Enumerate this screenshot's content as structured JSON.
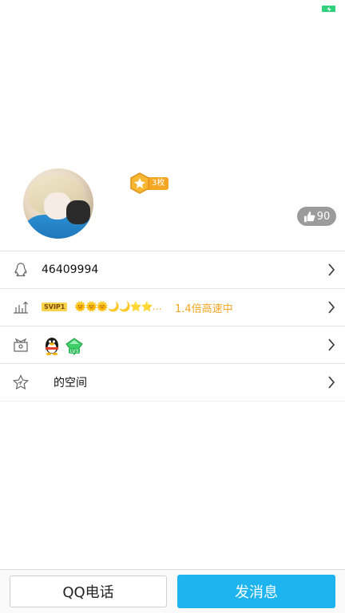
{
  "profile": {
    "medal_count": "3枚",
    "likes": "90"
  },
  "rows": [
    {
      "icon": "penguin-outline-icon",
      "text": "46409994"
    },
    {
      "icon": "level-chart-icon",
      "vip_tag": "SVIP1",
      "level_icons": "🌞🌞🌞🌙🌙⭐⭐…",
      "speed": "1.4倍高速中"
    },
    {
      "icon": "gift-icon",
      "badges": [
        "qq-penguin-icon",
        "lv3-gem-icon"
      ]
    },
    {
      "icon": "star-space-icon",
      "text": "的空间"
    }
  ],
  "bottom": {
    "call_label": "QQ电话",
    "message_label": "发消息"
  },
  "colors": {
    "accent": "#1eb4ef",
    "speed": "#f5a623",
    "battery": "#2fd27a"
  }
}
